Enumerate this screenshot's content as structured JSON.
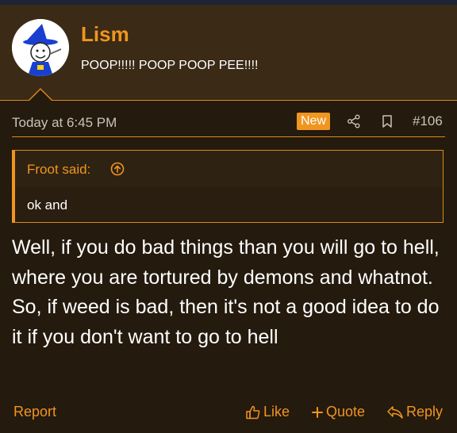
{
  "user": {
    "name": "Lism",
    "title": "POOP!!!!! POOP POOP PEE!!!!",
    "avatar_icon": "wizard-avatar-icon"
  },
  "meta": {
    "timestamp": "Today at 6:45 PM",
    "badge": "New",
    "post_number": "#106",
    "share_icon": "share-icon",
    "bookmark_icon": "bookmark-icon"
  },
  "quote": {
    "author": "Froot said:",
    "text": "ok and",
    "jump_icon": "arrow-up-circle-icon"
  },
  "post": {
    "body": "Well, if you do bad things than you will go to hell, where you are tortured by demons and whatnot. So, if weed is bad, then it's not a good idea to do it if you don't want to go to hell"
  },
  "footer": {
    "report": "Report",
    "like": "Like",
    "quote": "Quote",
    "reply": "Reply"
  },
  "colors": {
    "accent": "#f0951f",
    "background": "#241a0e",
    "header_bg": "#3a2a16",
    "badge_bg": "#f0951f"
  }
}
